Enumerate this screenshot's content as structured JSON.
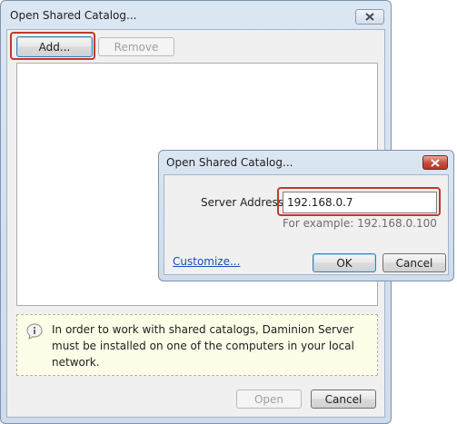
{
  "main_dialog": {
    "title": "Open Shared Catalog...",
    "add_label": "Add...",
    "remove_label": "Remove",
    "info_text": "In order to work with shared catalogs, Daminion Server must be installed on one of the computers in your local network.",
    "open_label": "Open",
    "cancel_label": "Cancel"
  },
  "sub_dialog": {
    "title": "Open Shared Catalog...",
    "server_label": "Server Address:",
    "server_value": "192.168.0.7",
    "hint": "For example: 192.168.0.100",
    "customize_label": "Customize...",
    "ok_label": "OK",
    "cancel_label": "Cancel"
  },
  "colors": {
    "highlight": "#c0392b",
    "link": "#1a4fb3",
    "close_red": "#c44b38"
  },
  "icons": [
    "close-icon",
    "info-icon"
  ]
}
